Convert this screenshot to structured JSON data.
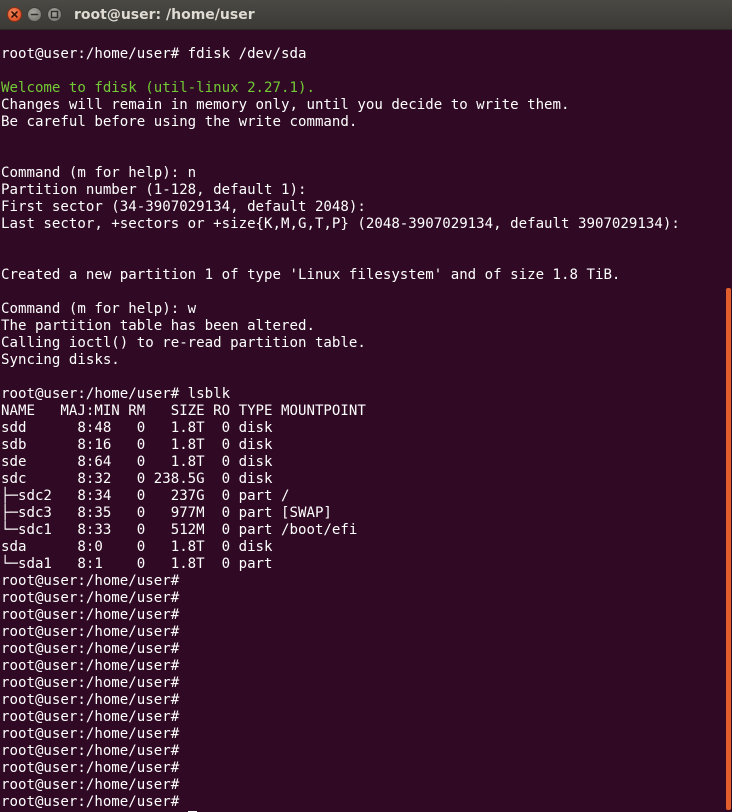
{
  "window": {
    "title": "root@user: /home/user"
  },
  "colors": {
    "background": "#300a24",
    "text": "#ffffff",
    "welcome_text": "#73c936",
    "scrollbar_thumb": "#e25e2c",
    "close_button": "#e0542a"
  },
  "terminal": {
    "lines": [
      "root@user:/home/user# fdisk /dev/sda",
      "",
      "Welcome to fdisk (util-linux 2.27.1).",
      "Changes will remain in memory only, until you decide to write them.",
      "Be careful before using the write command.",
      "",
      "",
      "Command (m for help): n",
      "Partition number (1-128, default 1):",
      "First sector (34-3907029134, default 2048):",
      "Last sector, +sectors or +size{K,M,G,T,P} (2048-3907029134, default 3907029134):",
      "",
      "",
      "Created a new partition 1 of type 'Linux filesystem' and of size 1.8 TiB.",
      "",
      "Command (m for help): w",
      "The partition table has been altered.",
      "Calling ioctl() to re-read partition table.",
      "Syncing disks.",
      "",
      "root@user:/home/user# lsblk",
      "NAME   MAJ:MIN RM   SIZE RO TYPE MOUNTPOINT",
      "sdd      8:48   0   1.8T  0 disk",
      "sdb      8:16   0   1.8T  0 disk",
      "sde      8:64   0   1.8T  0 disk",
      "sdc      8:32   0 238.5G  0 disk",
      "├─sdc2   8:34   0   237G  0 part /",
      "├─sdc3   8:35   0   977M  0 part [SWAP]",
      "└─sdc1   8:33   0   512M  0 part /boot/efi",
      "sda      8:0    0   1.8T  0 disk",
      "└─sda1   8:1    0   1.8T  0 part",
      "root@user:/home/user#",
      "root@user:/home/user#",
      "root@user:/home/user#",
      "root@user:/home/user#",
      "root@user:/home/user#",
      "root@user:/home/user#",
      "root@user:/home/user#",
      "root@user:/home/user#",
      "root@user:/home/user#",
      "root@user:/home/user#",
      "root@user:/home/user#",
      "root@user:/home/user#",
      "root@user:/home/user#",
      "root@user:/home/user#"
    ],
    "current_prompt": "root@user:/home/user# "
  }
}
